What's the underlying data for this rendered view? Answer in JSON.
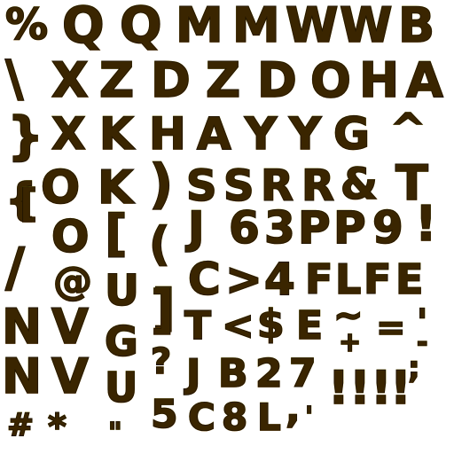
{
  "sheet": {
    "colors": {
      "top": "#fffa00",
      "bottom": "#ff8c00",
      "outline": "#1a1000"
    },
    "glyphs": [
      "%",
      "Q",
      "Q",
      "M",
      "M",
      "W",
      "W",
      "B",
      "\\",
      "X",
      "Z",
      "D",
      "Z",
      "D",
      "O",
      "H",
      "A",
      "}",
      "X",
      "K",
      "H",
      "A",
      "Y",
      "Y",
      "G",
      "^",
      "{",
      "O",
      "K",
      ")",
      "S",
      "S",
      "R",
      "R",
      "&",
      "T",
      "[",
      "O",
      "[",
      "(",
      "J",
      "6",
      "3",
      "P",
      "P",
      "9",
      "!",
      "/",
      "@",
      "U",
      "]",
      "C",
      ">",
      "4",
      "F",
      "L",
      "F",
      "E",
      "N",
      "V",
      "G",
      "]",
      "T",
      "<",
      "$",
      "E",
      "~",
      "=",
      "'",
      "N",
      "V",
      "U",
      "?",
      "J",
      "B",
      "2",
      "7",
      "!",
      "!",
      "!",
      "!",
      "+",
      ";",
      "-",
      "#",
      "*",
      "\"",
      "5",
      "C",
      "8",
      "L",
      ",",
      "'"
    ]
  }
}
